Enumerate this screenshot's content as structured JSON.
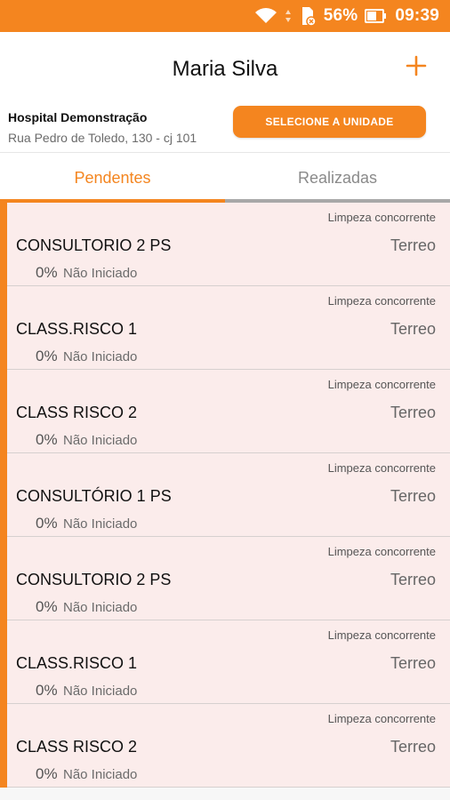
{
  "status_bar": {
    "battery": "56%",
    "time": "09:39",
    "icons": [
      "wifi-icon",
      "sd-card-icon",
      "battery-icon"
    ]
  },
  "app_bar": {
    "title": "Maria Silva",
    "add_icon": "plus-icon"
  },
  "hospital": {
    "name": "Hospital Demonstração",
    "address": "Rua Pedro de Toledo, 130 - cj 101",
    "select_unit_label": "SELECIONE A UNIDADE"
  },
  "tabs": [
    {
      "label": "Pendentes",
      "active": true
    },
    {
      "label": "Realizadas",
      "active": false
    }
  ],
  "tasks": [
    {
      "type": "Limpeza concorrente",
      "name": "CONSULTORIO 2 PS",
      "floor": "Terreo",
      "progress": "0%",
      "status": "Não Iniciado"
    },
    {
      "type": "Limpeza concorrente",
      "name": "CLASS.RISCO 1",
      "floor": "Terreo",
      "progress": "0%",
      "status": "Não Iniciado"
    },
    {
      "type": "Limpeza concorrente",
      "name": "CLASS RISCO 2",
      "floor": "Terreo",
      "progress": "0%",
      "status": "Não Iniciado"
    },
    {
      "type": "Limpeza concorrente",
      "name": "CONSULTÓRIO 1 PS",
      "floor": "Terreo",
      "progress": "0%",
      "status": "Não Iniciado"
    },
    {
      "type": "Limpeza concorrente",
      "name": "CONSULTORIO 2 PS",
      "floor": "Terreo",
      "progress": "0%",
      "status": "Não Iniciado"
    },
    {
      "type": "Limpeza concorrente",
      "name": "CLASS.RISCO 1",
      "floor": "Terreo",
      "progress": "0%",
      "status": "Não Iniciado"
    },
    {
      "type": "Limpeza concorrente",
      "name": "CLASS RISCO 2",
      "floor": "Terreo",
      "progress": "0%",
      "status": "Não Iniciado"
    }
  ],
  "colors": {
    "accent": "#f4851f",
    "list_background": "#fbeceb"
  }
}
